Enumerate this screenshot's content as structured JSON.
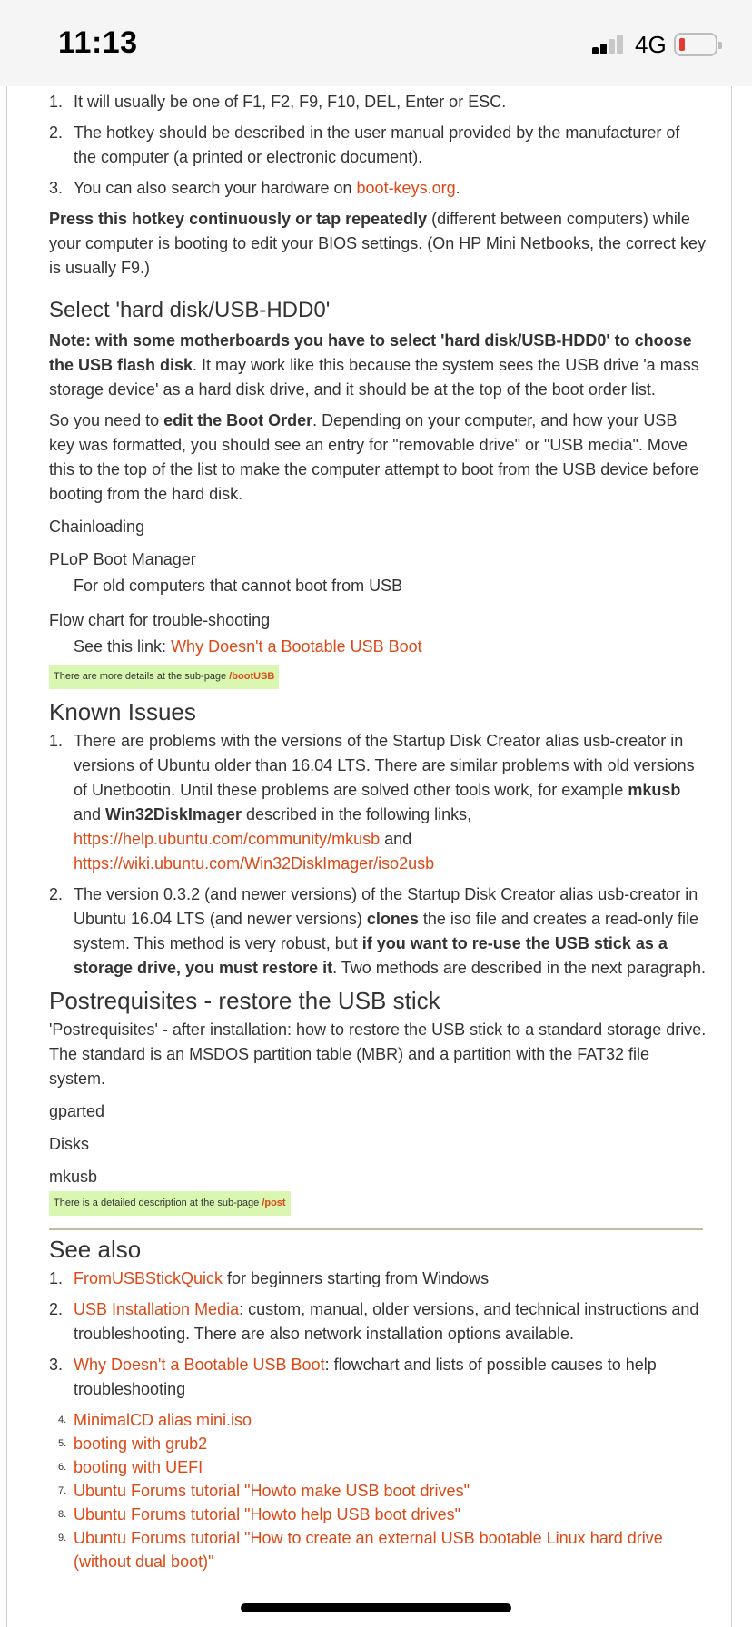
{
  "status": {
    "time": "11:13",
    "network": "4G"
  },
  "hotkey_list": [
    {
      "num": "1.",
      "text": "It will usually be one of F1, F2, F9, F10, DEL, Enter or ESC."
    },
    {
      "num": "2.",
      "text": "The hotkey should be described in the user manual provided by the manufacturer of the computer (a printed or electronic document)."
    },
    {
      "num": "3.",
      "pre": "You can also search your hardware on ",
      "link": "boot-keys.org",
      "post": "."
    }
  ],
  "hotkey_para": {
    "bold": "Press this hotkey continuously or tap repeatedly",
    "rest": " (different between computers) while your computer is booting to edit your BIOS settings. (On HP Mini Netbooks, the correct key is usually F9.)"
  },
  "select_hdd": {
    "heading": "Select 'hard disk/USB-HDD0'",
    "note_bold": "Note: with some motherboards you have to select 'hard disk/USB-HDD0' to choose the USB flash disk",
    "note_rest": ". It may work like this because the system sees the USB drive 'a mass storage device' as a hard disk drive, and it should be at the top of the boot order list.",
    "p2_pre": "So you need to ",
    "p2_bold": "edit the Boot Order",
    "p2_rest": ". Depending on your computer, and how your USB key was formatted, you should see an entry for \"removable drive\" or \"USB media\". Move this to the top of the list to make the computer attempt to boot from the USB device before booting from the hard disk."
  },
  "chainloading": "Chainloading",
  "plop": {
    "term": "PLoP Boot Manager",
    "def": "For old computers that cannot boot from USB"
  },
  "flowchart": {
    "term": "Flow chart for trouble-shooting",
    "pre": "See this link: ",
    "link": "Why Doesn't a Bootable USB Boot"
  },
  "note1": {
    "text": "There are more details at the sub-page ",
    "link": "/bootUSB"
  },
  "known_issues": {
    "heading": "Known Issues",
    "item1": {
      "num": "1.",
      "t1": "There are problems with the versions of the Startup Disk Creator alias usb-creator in versions of Ubuntu older than 16.04 LTS. There are similar problems with old versions of Unetbootin. Until these problems are solved other tools work, for example ",
      "b1": "mkusb",
      "t2": " and ",
      "b2": "Win32DiskImager",
      "t3": " described in the following links, ",
      "link1": "https://help.ubuntu.com/community/mkusb",
      "t4": " and ",
      "link2": "https://wiki.ubuntu.com/Win32DiskImager/iso2usb"
    },
    "item2": {
      "num": "2.",
      "t1": "The version 0.3.2 (and newer versions) of the Startup Disk Creator alias usb-creator in Ubuntu 16.04 LTS (and newer versions) ",
      "b1": "clones",
      "t2": " the iso file and creates a read-only file system. This method is very robust, but ",
      "b2": "if you want to re-use the USB stick as a storage drive, you must restore it",
      "t3": ". Two methods are described in the next paragraph."
    }
  },
  "postreq": {
    "heading": "Postrequisites - restore the USB stick",
    "para": "'Postrequisites' - after installation: how to restore the USB stick to a standard storage drive. The standard is an MSDOS partition table (MBR) and a partition with the FAT32 file system.",
    "tools": [
      "gparted",
      "Disks",
      "mkusb"
    ]
  },
  "note2": {
    "text": "There is a detailed description at the sub-page ",
    "link": "/post"
  },
  "see_also": {
    "heading": "See also",
    "items": [
      {
        "num": "1.",
        "link": "FromUSBStickQuick",
        "rest": " for beginners starting from Windows"
      },
      {
        "num": "2.",
        "link": "USB Installation Media",
        "rest": ": custom, manual, older versions, and technical instructions and troubleshooting. There are also network installation options available."
      },
      {
        "num": "3.",
        "link": "Why Doesn't a Bootable USB Boot",
        "rest": ": flowchart and lists of possible causes to help troubleshooting"
      }
    ],
    "small_items": [
      {
        "num": "4.",
        "link": "MinimalCD alias mini.iso"
      },
      {
        "num": "5.",
        "link": "booting with grub2"
      },
      {
        "num": "6.",
        "link": "booting with UEFI"
      },
      {
        "num": "7.",
        "link": "Ubuntu Forums tutorial \"Howto make USB boot drives\""
      },
      {
        "num": "8.",
        "link": "Ubuntu Forums tutorial \"Howto help USB boot drives\""
      },
      {
        "num": "9.",
        "link": "Ubuntu Forums tutorial \"How to create an external USB bootable Linux hard drive (without dual boot)\""
      }
    ]
  },
  "colors": {
    "link": "#dd4814",
    "note_bg": "#d9f7b0",
    "text": "#333333"
  }
}
